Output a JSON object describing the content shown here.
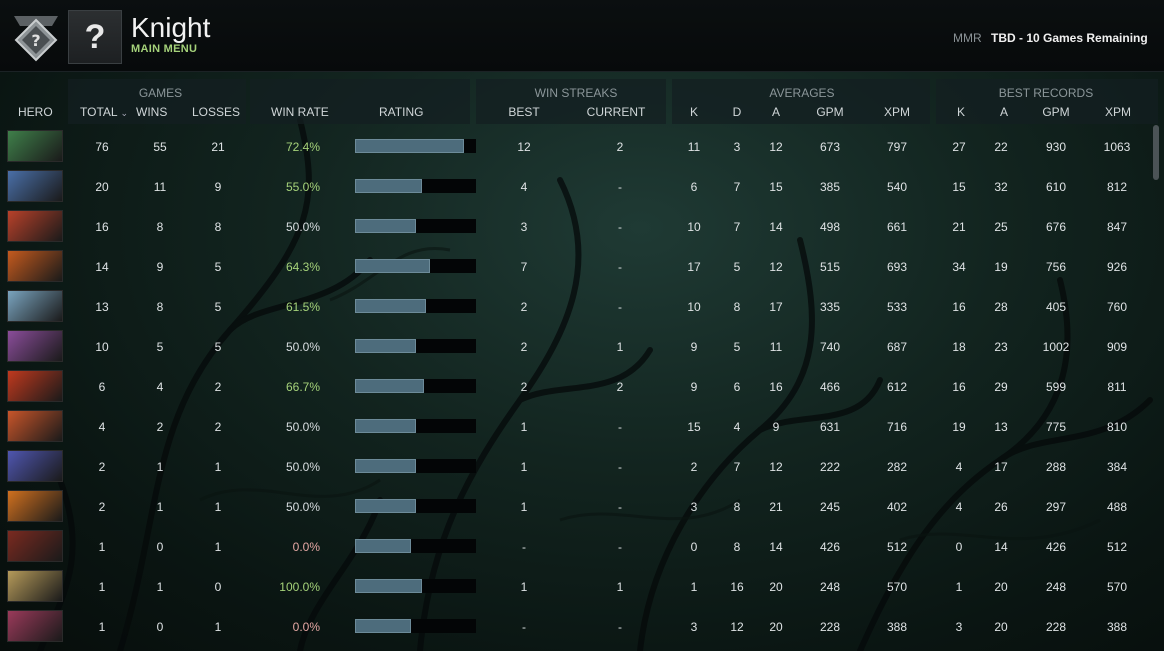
{
  "player": {
    "name": "Knight",
    "subtitle": "MAIN MENU",
    "avatar_glyph": "?"
  },
  "mmr": {
    "label": "MMR",
    "value": "TBD - 10 Games Remaining"
  },
  "groups": {
    "games": "GAMES",
    "streaks": "WIN STREAKS",
    "averages": "AVERAGES",
    "records": "BEST RECORDS"
  },
  "columns": {
    "hero": "HERO",
    "total": "TOTAL",
    "wins": "WINS",
    "losses": "LOSSES",
    "winrate": "WIN RATE",
    "rating": "RATING",
    "best": "BEST",
    "current": "CURRENT",
    "k": "K",
    "d": "D",
    "a": "A",
    "gpm": "GPM",
    "xpm": "XPM",
    "rk": "K",
    "ra": "A",
    "rgpm": "GPM",
    "rxpm": "XPM"
  },
  "sort_icon": "chevron-down-icon",
  "colors": {
    "winrate_good": "#a5d27a",
    "winrate_even": "#d8dde0",
    "winrate_bad": "#e4a7a3",
    "bar": "#4d6c7c"
  },
  "rows": [
    {
      "hero_color": "#3f7f4a",
      "total": "76",
      "wins": "55",
      "losses": "21",
      "winrate": "72.4%",
      "rating": 0.9,
      "best": "12",
      "current": "2",
      "k": "11",
      "d": "3",
      "a": "12",
      "gpm": "673",
      "xpm": "797",
      "rk": "27",
      "ra": "22",
      "rgpm": "930",
      "rxpm": "1063"
    },
    {
      "hero_color": "#4a6fa8",
      "total": "20",
      "wins": "11",
      "losses": "9",
      "winrate": "55.0%",
      "rating": 0.55,
      "best": "4",
      "current": "-",
      "k": "6",
      "d": "7",
      "a": "15",
      "gpm": "385",
      "xpm": "540",
      "rk": "15",
      "ra": "32",
      "rgpm": "610",
      "rxpm": "812"
    },
    {
      "hero_color": "#b8412a",
      "total": "16",
      "wins": "8",
      "losses": "8",
      "winrate": "50.0%",
      "rating": 0.5,
      "best": "3",
      "current": "-",
      "k": "10",
      "d": "7",
      "a": "14",
      "gpm": "498",
      "xpm": "661",
      "rk": "21",
      "ra": "25",
      "rgpm": "676",
      "rxpm": "847"
    },
    {
      "hero_color": "#c45a1e",
      "total": "14",
      "wins": "9",
      "losses": "5",
      "winrate": "64.3%",
      "rating": 0.62,
      "best": "7",
      "current": "-",
      "k": "17",
      "d": "5",
      "a": "12",
      "gpm": "515",
      "xpm": "693",
      "rk": "34",
      "ra": "19",
      "rgpm": "756",
      "rxpm": "926"
    },
    {
      "hero_color": "#7aa4bf",
      "total": "13",
      "wins": "8",
      "losses": "5",
      "winrate": "61.5%",
      "rating": 0.59,
      "best": "2",
      "current": "-",
      "k": "10",
      "d": "8",
      "a": "17",
      "gpm": "335",
      "xpm": "533",
      "rk": "16",
      "ra": "28",
      "rgpm": "405",
      "rxpm": "760"
    },
    {
      "hero_color": "#8a4d9a",
      "total": "10",
      "wins": "5",
      "losses": "5",
      "winrate": "50.0%",
      "rating": 0.5,
      "best": "2",
      "current": "1",
      "k": "9",
      "d": "5",
      "a": "11",
      "gpm": "740",
      "xpm": "687",
      "rk": "18",
      "ra": "23",
      "rgpm": "1002",
      "rxpm": "909"
    },
    {
      "hero_color": "#c0391e",
      "total": "6",
      "wins": "4",
      "losses": "2",
      "winrate": "66.7%",
      "rating": 0.57,
      "best": "2",
      "current": "2",
      "k": "9",
      "d": "6",
      "a": "16",
      "gpm": "466",
      "xpm": "612",
      "rk": "16",
      "ra": "29",
      "rgpm": "599",
      "rxpm": "811"
    },
    {
      "hero_color": "#c8552a",
      "total": "4",
      "wins": "2",
      "losses": "2",
      "winrate": "50.0%",
      "rating": 0.5,
      "best": "1",
      "current": "-",
      "k": "15",
      "d": "4",
      "a": "9",
      "gpm": "631",
      "xpm": "716",
      "rk": "19",
      "ra": "13",
      "rgpm": "775",
      "rxpm": "810"
    },
    {
      "hero_color": "#4f56b0",
      "total": "2",
      "wins": "1",
      "losses": "1",
      "winrate": "50.0%",
      "rating": 0.5,
      "best": "1",
      "current": "-",
      "k": "2",
      "d": "7",
      "a": "12",
      "gpm": "222",
      "xpm": "282",
      "rk": "4",
      "ra": "17",
      "rgpm": "288",
      "rxpm": "384"
    },
    {
      "hero_color": "#d0701f",
      "total": "2",
      "wins": "1",
      "losses": "1",
      "winrate": "50.0%",
      "rating": 0.5,
      "best": "1",
      "current": "-",
      "k": "3",
      "d": "8",
      "a": "21",
      "gpm": "245",
      "xpm": "402",
      "rk": "4",
      "ra": "26",
      "rgpm": "297",
      "rxpm": "488"
    },
    {
      "hero_color": "#7a2a20",
      "total": "1",
      "wins": "0",
      "losses": "1",
      "winrate": "0.0%",
      "rating": 0.46,
      "best": "-",
      "current": "-",
      "k": "0",
      "d": "8",
      "a": "14",
      "gpm": "426",
      "xpm": "512",
      "rk": "0",
      "ra": "14",
      "rgpm": "426",
      "rxpm": "512"
    },
    {
      "hero_color": "#b59a5a",
      "total": "1",
      "wins": "1",
      "losses": "0",
      "winrate": "100.0%",
      "rating": 0.55,
      "best": "1",
      "current": "1",
      "k": "1",
      "d": "16",
      "a": "20",
      "gpm": "248",
      "xpm": "570",
      "rk": "1",
      "ra": "20",
      "rgpm": "248",
      "rxpm": "570"
    },
    {
      "hero_color": "#9a3a5a",
      "total": "1",
      "wins": "0",
      "losses": "1",
      "winrate": "0.0%",
      "rating": 0.46,
      "best": "-",
      "current": "-",
      "k": "3",
      "d": "12",
      "a": "20",
      "gpm": "228",
      "xpm": "388",
      "rk": "3",
      "ra": "20",
      "rgpm": "228",
      "rxpm": "388"
    }
  ]
}
